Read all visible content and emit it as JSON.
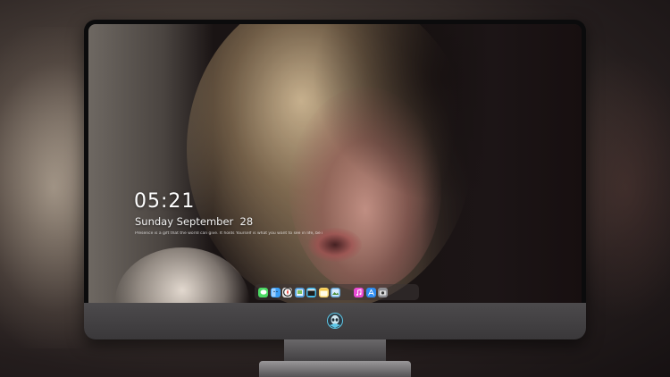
{
  "lockscreen": {
    "time": "05:21",
    "date": "Sunday September  28",
    "quote": "Presence is a gift that the world can give. It holds Yourself is what you want to see in life, be it"
  },
  "dock": {
    "apps": [
      {
        "icon": "messages-icon",
        "color": "#4cd964"
      },
      {
        "icon": "finder-icon",
        "color": "#3b9ef5"
      },
      {
        "icon": "safari-icon",
        "color": "#e8e8e8"
      },
      {
        "icon": "preview-icon",
        "color": "#5aa3e0"
      },
      {
        "icon": "claquette-icon",
        "color": "#48b8e8"
      },
      {
        "icon": "notes-icon",
        "color": "#f6d36b"
      },
      {
        "icon": "photos-icon",
        "color": "#66a8d8"
      },
      {
        "icon": "itunes-icon",
        "color": "#e94bd3"
      },
      {
        "icon": "app-store-icon",
        "color": "#2f8cf0"
      },
      {
        "icon": "camera-icon",
        "color": "#8e8e93"
      }
    ]
  },
  "colors": {
    "monitor_bezel": "#0b0b0c",
    "chin": "#4c4a4c",
    "clock_text": "#ffffff"
  }
}
